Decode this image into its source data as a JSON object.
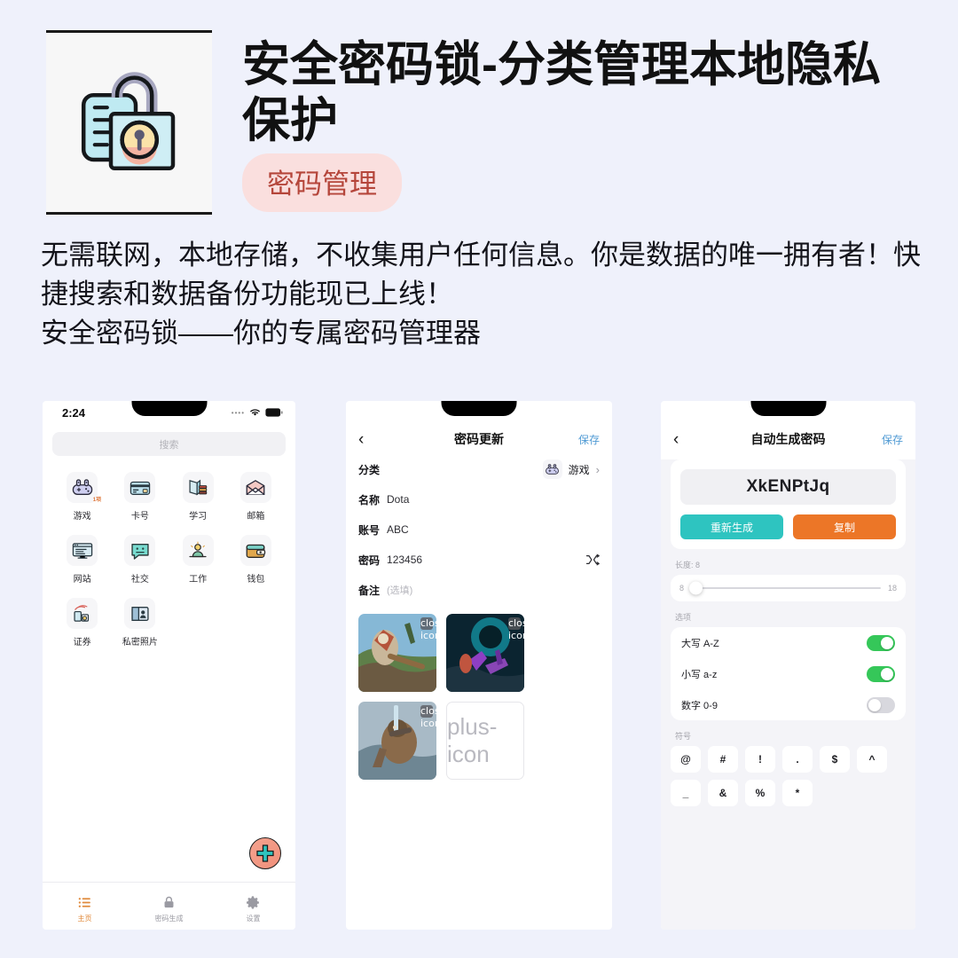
{
  "header": {
    "app_title": "安全密码锁-分类管理本地隐私保护",
    "badge": "密码管理",
    "icon": "padlock-card-icon"
  },
  "description": {
    "line1": "无需联网，本地存储，不收集用户任何信息。你是数据的唯一拥有者！快捷搜索和数据备份功能现已上线！",
    "line2": "安全密码锁——你的专属密码管理器"
  },
  "phone1": {
    "status": {
      "time": "2:24",
      "dots": "••••"
    },
    "search_placeholder": "搜索",
    "categories": [
      {
        "label": "游戏",
        "icon": "gamepad-icon",
        "badge": "1项"
      },
      {
        "label": "卡号",
        "icon": "credit-card-icon",
        "badge": ""
      },
      {
        "label": "学习",
        "icon": "books-icon",
        "badge": ""
      },
      {
        "label": "邮箱",
        "icon": "envelope-icon",
        "badge": ""
      },
      {
        "label": "网站",
        "icon": "monitor-icon",
        "badge": ""
      },
      {
        "label": "社交",
        "icon": "chat-bubble-icon",
        "badge": ""
      },
      {
        "label": "工作",
        "icon": "workdesk-icon",
        "badge": ""
      },
      {
        "label": "钱包",
        "icon": "wallet-icon",
        "badge": ""
      },
      {
        "label": "证券",
        "icon": "stocks-icon",
        "badge": ""
      },
      {
        "label": "私密照片",
        "icon": "private-photo-icon",
        "badge": ""
      }
    ],
    "fab": "add-icon",
    "tabs": [
      {
        "label": "主页",
        "icon": "list-icon",
        "active": true
      },
      {
        "label": "密码生成",
        "icon": "lock-icon",
        "active": false
      },
      {
        "label": "设置",
        "icon": "gear-icon",
        "active": false
      }
    ]
  },
  "phone2": {
    "nav": {
      "back": "‹",
      "title": "密码更新",
      "action": "保存"
    },
    "fields": {
      "category_label": "分类",
      "category_value": "游戏",
      "category_icon": "gamepad-icon",
      "name_label": "名称",
      "name_value": "Dota",
      "account_label": "账号",
      "account_value": "ABC",
      "password_label": "密码",
      "password_value": "123456",
      "password_action_icon": "shuffle-icon",
      "note_label": "备注",
      "note_placeholder": "(选填)"
    },
    "attachments": {
      "remove_icon": "close-icon",
      "add_icon": "plus-icon",
      "items": [
        {
          "alt": "dota-hero-1",
          "c1": "#7fb6d8",
          "c2": "#6d8a4e",
          "c3": "#8c5a3c"
        },
        {
          "alt": "dota-hero-2",
          "c1": "#0d2a38",
          "c2": "#16c4d6",
          "c3": "#8a3fc0"
        },
        {
          "alt": "dota-hero-3",
          "c1": "#9fb2bf",
          "c2": "#5f7785",
          "c3": "#8a6a4a"
        }
      ]
    }
  },
  "phone3": {
    "nav": {
      "back": "‹",
      "title": "自动生成密码",
      "action": "保存"
    },
    "generated_password": "XkENPtJq",
    "buttons": {
      "regenerate": "重新生成",
      "copy": "复制"
    },
    "length": {
      "label": "长度: 8",
      "min": "8",
      "max": "18",
      "value": 8
    },
    "options_label": "选项",
    "options": [
      {
        "label": "大写 A-Z",
        "on": true
      },
      {
        "label": "小写 a-z",
        "on": true
      },
      {
        "label": "数字 0-9",
        "on": false
      }
    ],
    "symbols_label": "符号",
    "symbols": [
      "@",
      "#",
      "!",
      ".",
      "$",
      "^",
      "_",
      "&",
      "%",
      "*"
    ]
  },
  "colors": {
    "page_bg": "#eff1fb",
    "badge_bg": "#fadfde",
    "badge_fg": "#b5463b",
    "accent_orange": "#e08a3c",
    "link_blue": "#4f9ad4",
    "teal": "#2ec4c0",
    "copy_orange": "#ec7627",
    "switch_on": "#35c759"
  }
}
